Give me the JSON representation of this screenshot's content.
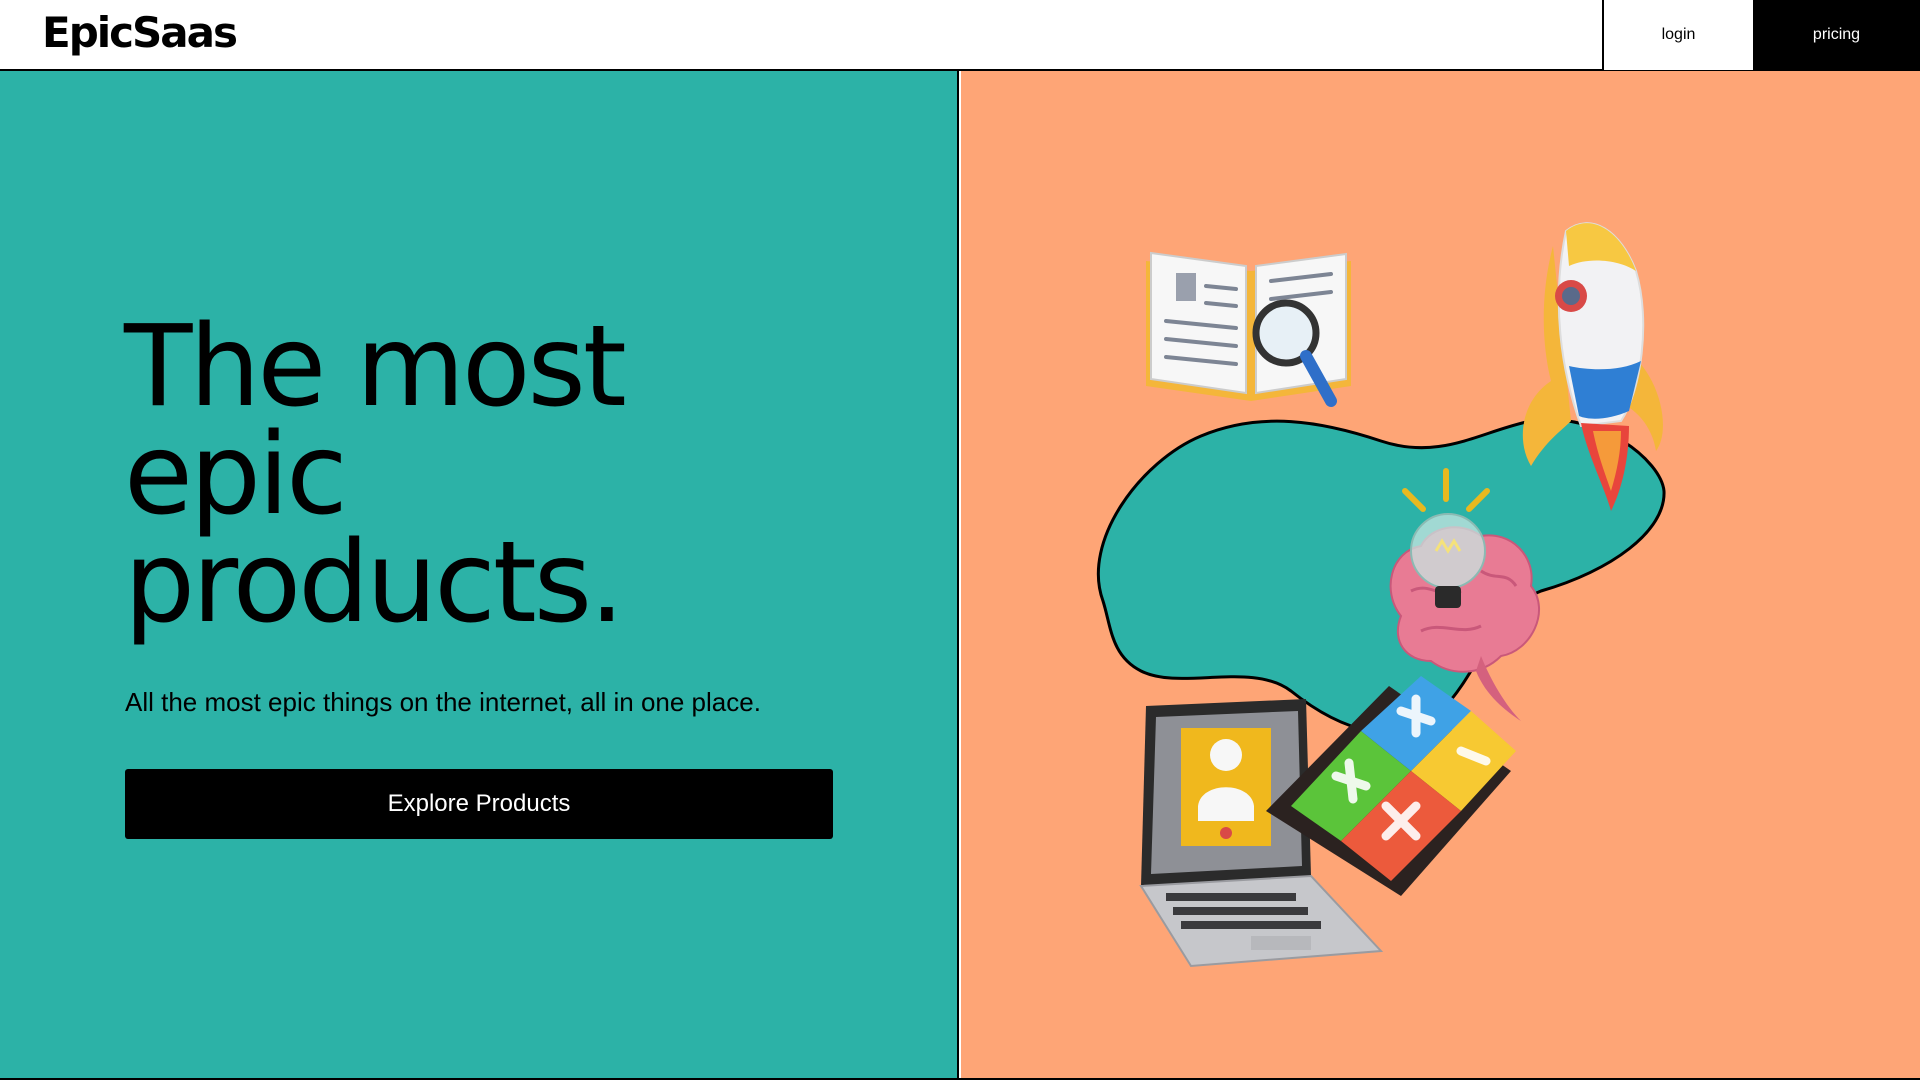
{
  "header": {
    "logo": "EpicSaas",
    "nav": {
      "login": "login",
      "pricing": "pricing"
    }
  },
  "hero": {
    "title_lines": [
      "The most",
      "epic",
      "products."
    ],
    "subtitle": "All the most epic things on the internet, all in one place.",
    "cta_label": "Explore Products"
  },
  "colors": {
    "left_panel": "#2cb2a7",
    "right_panel": "#fea576",
    "button": "#000000"
  },
  "illustration_icons": [
    "book-magnifier-icon",
    "rocket-icon",
    "lightbulb-brain-icon",
    "laptop-user-icon",
    "calculator-keys-icon"
  ]
}
